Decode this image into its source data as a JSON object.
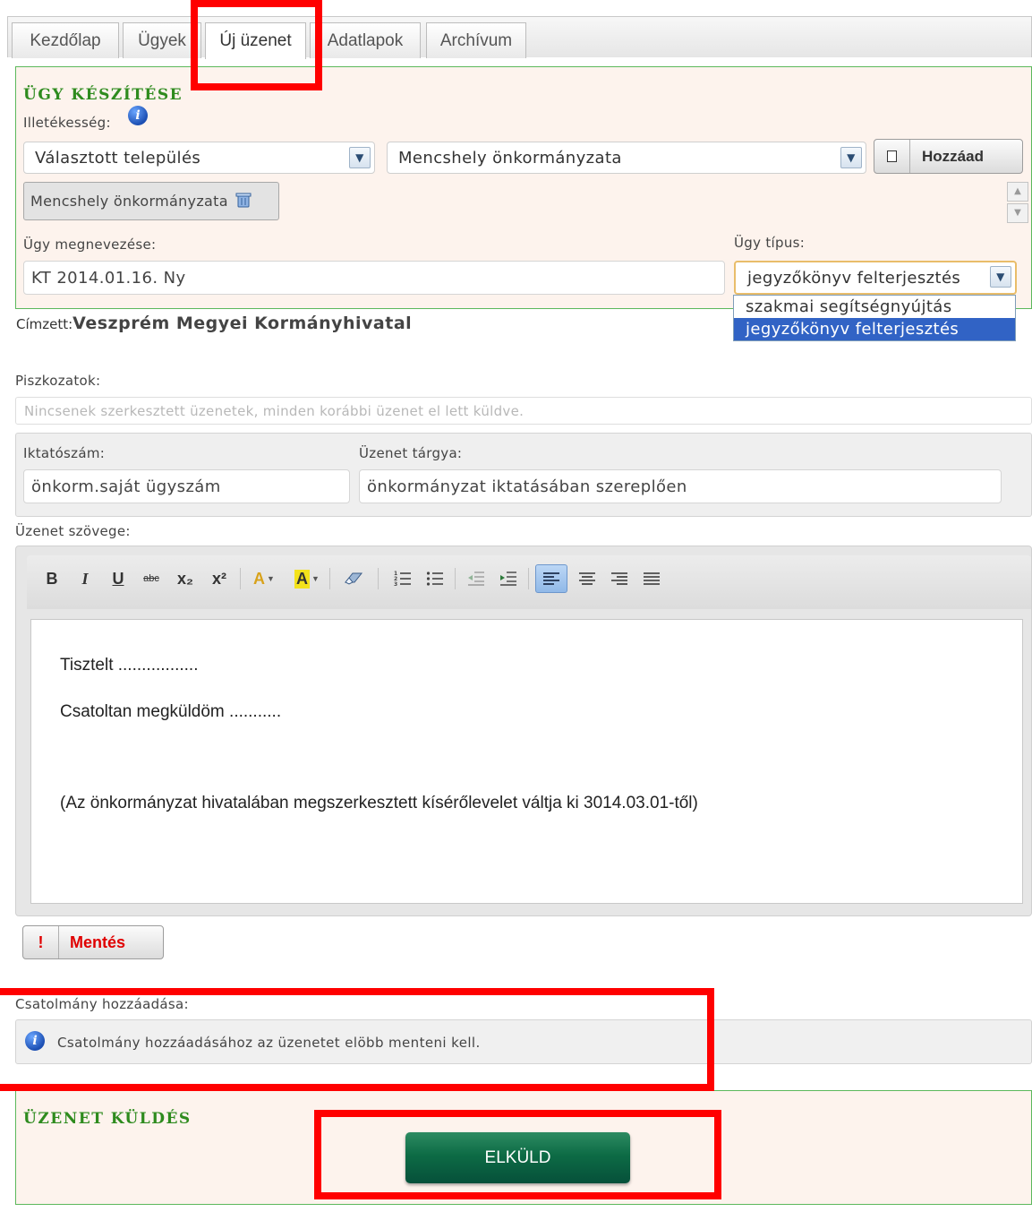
{
  "tabs": [
    {
      "label": "Kezdőlap"
    },
    {
      "label": "Ügyek"
    },
    {
      "label": "Új üzenet"
    },
    {
      "label": "Adatlapok"
    },
    {
      "label": "Archívum"
    }
  ],
  "case_section": {
    "title": "ÜGY KÉSZÍTÉSE",
    "jurisdiction_label": "Illetékesség:",
    "jurisdiction_select": "Választott település",
    "office_select": "Mencshely önkormányzata",
    "add_button": "Hozzáad",
    "selected_chip": "Mencshely önkormányzata",
    "case_name_label": "Ügy megnevezése:",
    "case_name_value": "KT 2014.01.16. Ny",
    "case_type_label": "Ügy típus:",
    "case_type_value": "jegyzőkönyv felterjesztés",
    "case_type_options": [
      "szakmai segítségnyújtás",
      "jegyzőkönyv felterjesztés"
    ]
  },
  "recipient": {
    "label": "Címzett:",
    "value": "Veszprém Megyei Kormányhivatal"
  },
  "drafts": {
    "label": "Piszkozatok:",
    "placeholder": "Nincsenek szerkesztett üzenetek, minden korábbi üzenet el lett küldve."
  },
  "registration": {
    "number_label": "Iktatószám:",
    "number_value": "önkorm.saját ügyszám",
    "subject_label": "Üzenet tárgya:",
    "subject_value": "önkormányzat iktatásában szereplően"
  },
  "message": {
    "label": "Üzenet szövege:",
    "line1": "Tisztelt .................",
    "line2": "Csatoltan megküldöm ...........",
    "line3": "(Az önkormányzat hivatalában megszerkesztett kísérőlevelet váltja ki 3014.03.01-től)"
  },
  "toolbar": {
    "bold": "B",
    "italic": "I",
    "underline": "U",
    "strike": "abc",
    "subscript": "x₂",
    "superscript": "x²",
    "font_color": "A",
    "highlight": "A"
  },
  "save_button": {
    "icon": "!",
    "label": "Mentés"
  },
  "attachment": {
    "label": "Csatolmány hozzáadása:",
    "info": "Csatolmány hozzáadásához az üzenetet elöbb menteni kell."
  },
  "send_section": {
    "title": "ÜZENET KÜLDÉS",
    "button": "ELKÜLD"
  },
  "colors": {
    "accent_green": "#2e8b1e",
    "send_button": "#0d6b45",
    "highlight_red": "#ff0000",
    "selected_option": "#3163c5"
  }
}
